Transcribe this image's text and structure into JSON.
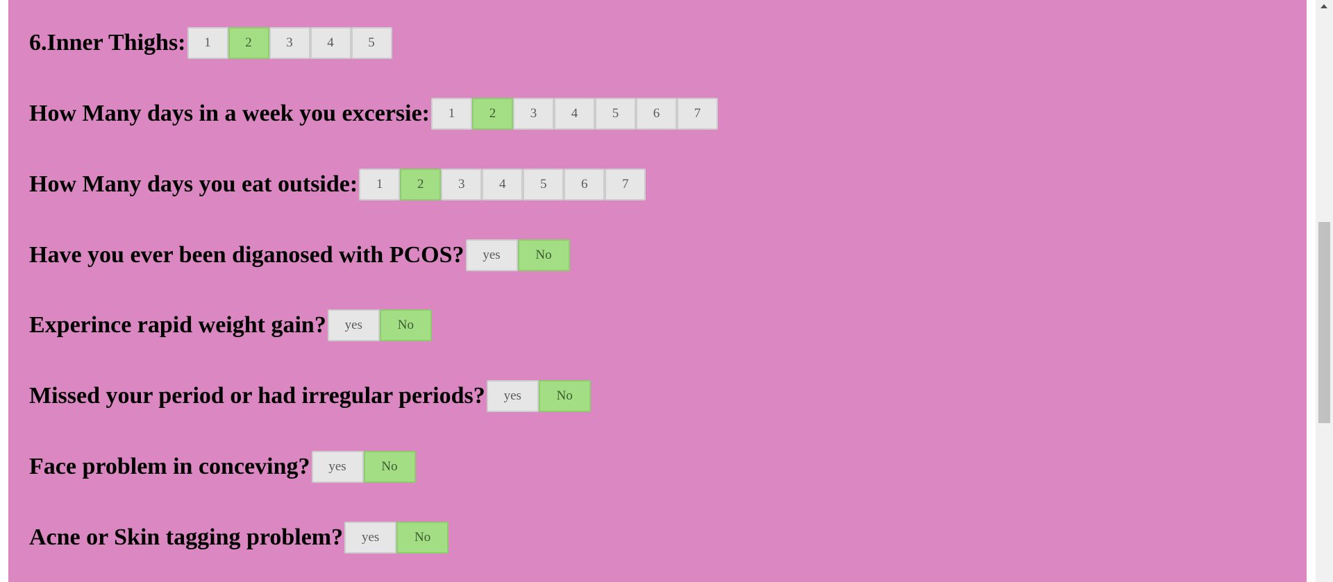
{
  "questions": [
    {
      "label": "6.Inner Thighs:",
      "kind": "num",
      "options": [
        "1",
        "2",
        "3",
        "4",
        "5"
      ],
      "selected": "2"
    },
    {
      "label": "How Many days in a week you excersie:",
      "kind": "num",
      "options": [
        "1",
        "2",
        "3",
        "4",
        "5",
        "6",
        "7"
      ],
      "selected": "2"
    },
    {
      "label": "How Many days you eat outside:",
      "kind": "num",
      "options": [
        "1",
        "2",
        "3",
        "4",
        "5",
        "6",
        "7"
      ],
      "selected": "2"
    },
    {
      "label": "Have you ever been diganosed with PCOS?",
      "kind": "yn",
      "options": [
        "yes",
        "No"
      ],
      "selected": "No"
    },
    {
      "label": "Experince rapid weight gain?",
      "kind": "yn",
      "options": [
        "yes",
        "No"
      ],
      "selected": "No"
    },
    {
      "label": "Missed your period or had irregular periods?",
      "kind": "yn",
      "options": [
        "yes",
        "No"
      ],
      "selected": "No"
    },
    {
      "label": "Face problem in conceving?",
      "kind": "yn",
      "options": [
        "yes",
        "No"
      ],
      "selected": "No"
    },
    {
      "label": "Acne or Skin tagging problem?",
      "kind": "yn",
      "options": [
        "yes",
        "No"
      ],
      "selected": "No"
    }
  ],
  "colors": {
    "page_background": "#db87c1",
    "option_default": "#e6e6e6",
    "option_selected": "#a3de85"
  }
}
